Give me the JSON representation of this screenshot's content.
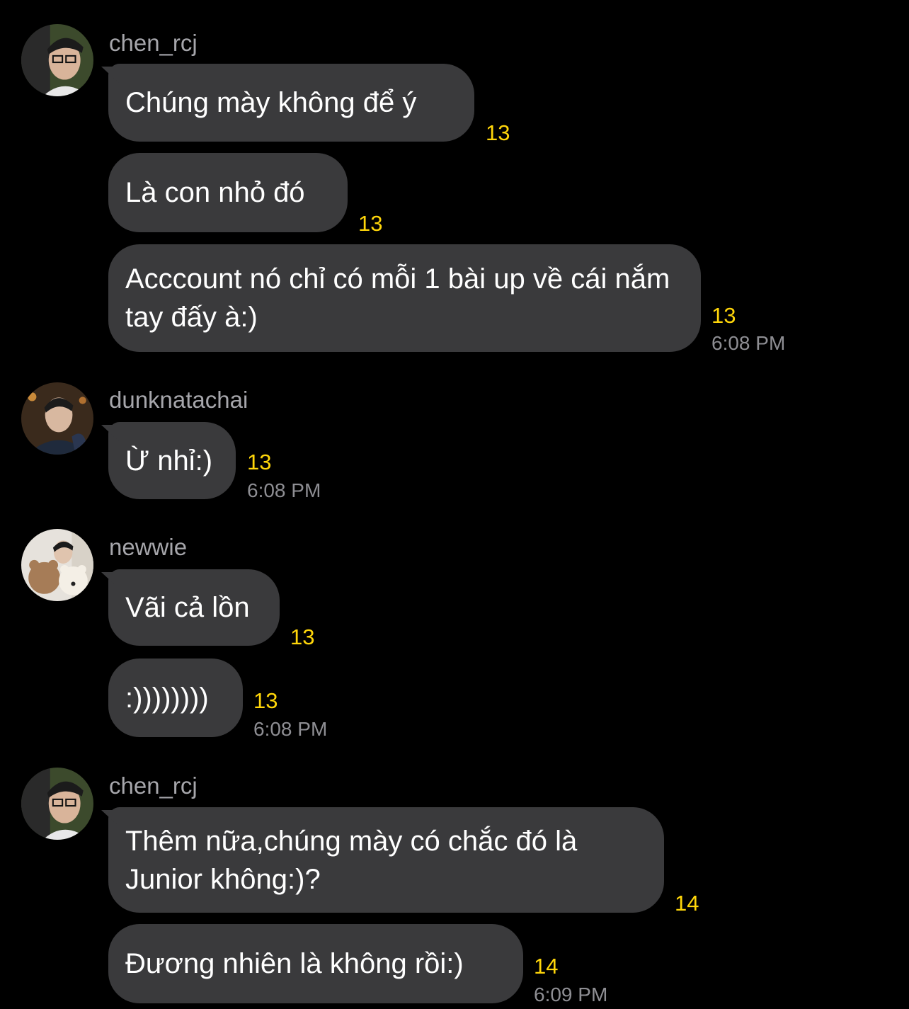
{
  "messages": [
    {
      "sender": "chen_rcj",
      "avatar": "profile-photo-icon",
      "bubbles": [
        {
          "text": "Chúng mày không để ý",
          "count": "13"
        },
        {
          "text": "Là con nhỏ đó",
          "count": "13"
        },
        {
          "text": "Acccount nó chỉ có mỗi 1 bài up về cái nắm tay đấy à:)",
          "count": "13",
          "time": "6:08 PM"
        }
      ]
    },
    {
      "sender": "dunknatachai",
      "avatar": "profile-photo-icon",
      "bubbles": [
        {
          "text": "Ừ nhỉ:)",
          "count": "13",
          "time": "6:08 PM"
        }
      ]
    },
    {
      "sender": "newwie",
      "avatar": "profile-photo-icon",
      "bubbles": [
        {
          "text": "Vãi cả lồn",
          "count": "13"
        },
        {
          "text": ":))))))))",
          "count": "13",
          "time": "6:08 PM"
        }
      ]
    },
    {
      "sender": "chen_rcj",
      "avatar": "profile-photo-icon",
      "bubbles": [
        {
          "text": "Thêm nữa,chúng mày có chắc đó là Junior không:)?",
          "count": "14"
        },
        {
          "text": "Đương nhiên là không rồi:)",
          "count": "14",
          "time": "6:09 PM"
        }
      ]
    }
  ],
  "colors": {
    "background": "#000000",
    "bubble": "#3a3a3c",
    "count": "#ffd60a",
    "sender": "#a6a6ab",
    "time": "#8e8e93"
  }
}
